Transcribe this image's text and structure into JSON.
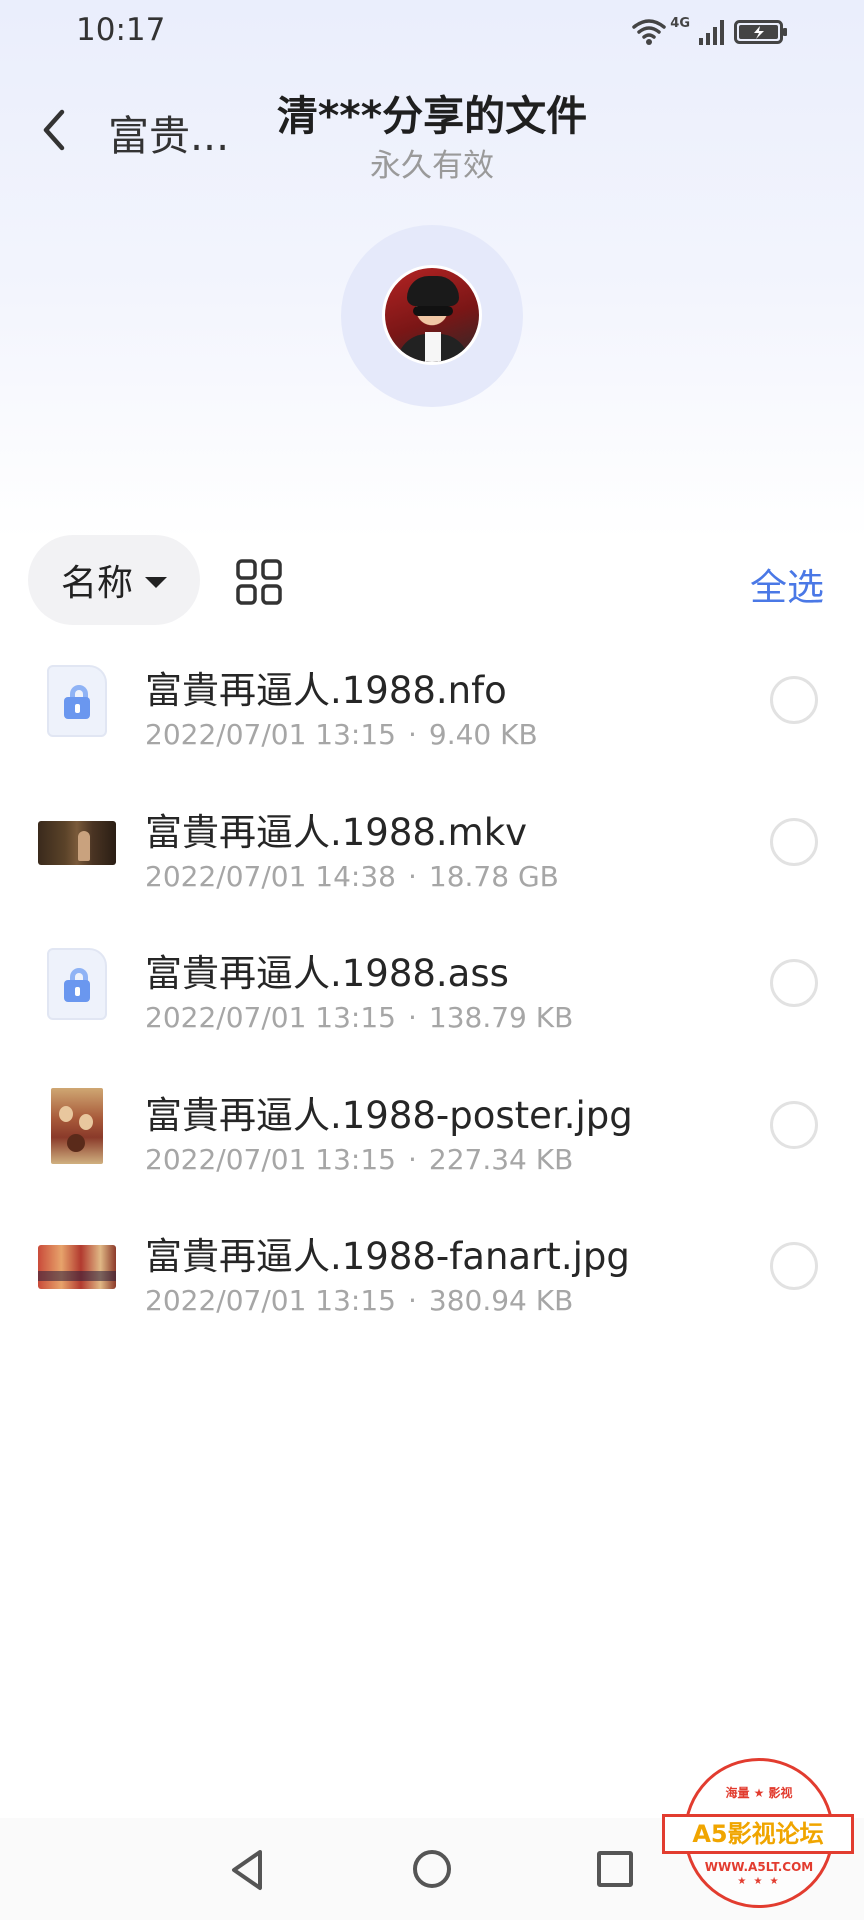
{
  "status_bar": {
    "time": "10:17",
    "network": "4G",
    "icons": [
      "wifi-icon",
      "signal-icon",
      "battery-icon"
    ]
  },
  "header": {
    "back_icon": "chevron-left-icon",
    "breadcrumb": "富贵...",
    "title": "清***分享的文件",
    "subtitle": "永久有效"
  },
  "toolbar": {
    "sort_label": "名称",
    "sort_icon": "caret-down-icon",
    "view_icon": "grid-view-icon",
    "select_all": "全选",
    "accent_color": "#4a78e6"
  },
  "files": [
    {
      "name": "富貴再逼人.1988.nfo",
      "date": "2022/07/01 13:15",
      "size": "9.40 KB",
      "thumb": "doc-lock-icon"
    },
    {
      "name": "富貴再逼人.1988.mkv",
      "date": "2022/07/01 14:38",
      "size": "18.78 GB",
      "thumb": "video-thumbnail"
    },
    {
      "name": "富貴再逼人.1988.ass",
      "date": "2022/07/01 13:15",
      "size": "138.79 KB",
      "thumb": "doc-lock-icon"
    },
    {
      "name": "富貴再逼人.1988-poster.jpg",
      "date": "2022/07/01 13:15",
      "size": "227.34 KB",
      "thumb": "poster-thumbnail"
    },
    {
      "name": "富貴再逼人.1988-fanart.jpg",
      "date": "2022/07/01 13:15",
      "size": "380.94 KB",
      "thumb": "fanart-thumbnail"
    }
  ],
  "meta_separator": "·",
  "nav_bar": {
    "icons": [
      "nav-back-icon",
      "nav-home-icon",
      "nav-recents-icon"
    ]
  },
  "watermark": {
    "top": "海量 ★ 影视",
    "main": "A5影视论坛",
    "url": "WWW.A5LT.COM",
    "stars": "★ ★ ★",
    "color": "#e23c2f"
  }
}
